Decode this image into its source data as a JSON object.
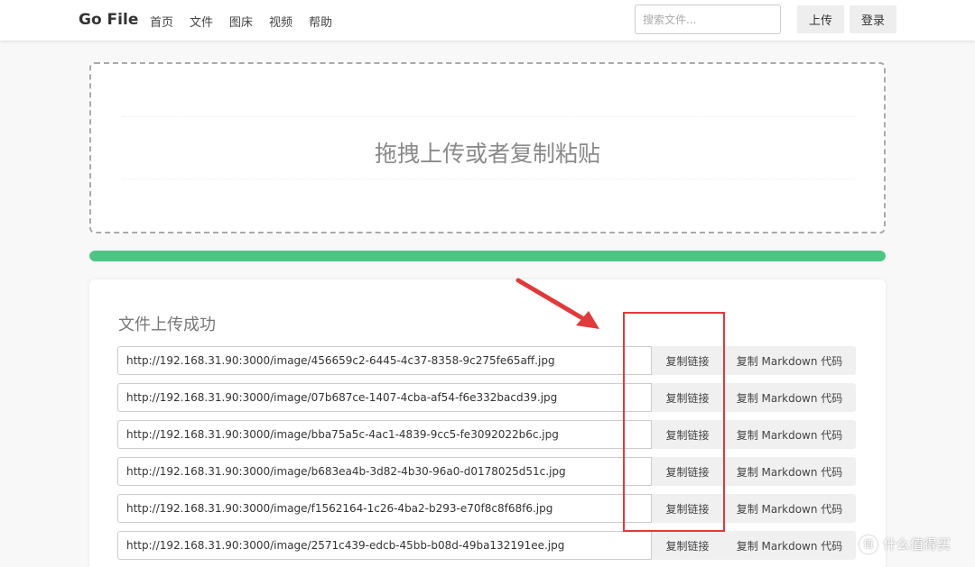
{
  "app": {
    "brand": "Go File",
    "nav": [
      "首页",
      "文件",
      "图床",
      "视频",
      "帮助"
    ],
    "search_placeholder": "搜索文件...",
    "upload_label": "上传",
    "login_label": "登录"
  },
  "dropzone": {
    "text": "拖拽上传或者复制粘贴"
  },
  "progress": {
    "fraction": 1.0,
    "color": "#4cc584"
  },
  "result": {
    "title": "文件上传成功",
    "copy_link_label": "复制链接",
    "copy_md_label": "复制 Markdown 代码",
    "urls": [
      "http://192.168.31.90:3000/image/456659c2-6445-4c37-8358-9c275fe65aff.jpg",
      "http://192.168.31.90:3000/image/07b687ce-1407-4cba-af54-f6e332bacd39.jpg",
      "http://192.168.31.90:3000/image/bba75a5c-4ac1-4839-9cc5-fe3092022b6c.jpg",
      "http://192.168.31.90:3000/image/b683ea4b-3d82-4b30-96a0-d0178025d51c.jpg",
      "http://192.168.31.90:3000/image/f1562164-1c26-4ba2-b293-e70f8c8f68f6.jpg",
      "http://192.168.31.90:3000/image/2571c439-edcb-45bb-b08d-49ba132191ee.jpg"
    ]
  },
  "watermark": {
    "text": "什么值得买",
    "logo_glyph": "值"
  },
  "colors": {
    "annotation": "#e03a3a"
  }
}
